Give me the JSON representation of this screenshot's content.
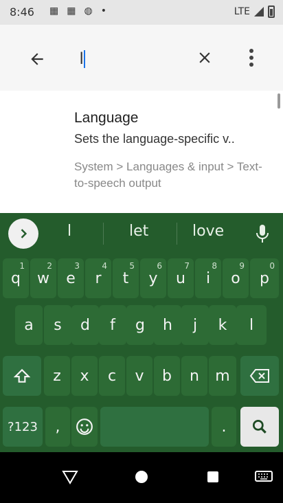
{
  "status_bar": {
    "time": "8:46",
    "network": "LTE",
    "icons": [
      "calendar-31-icon",
      "calendar-31-icon",
      "wifi-icon",
      "dot-icon"
    ]
  },
  "search_bar": {
    "query": "l",
    "back_icon": "arrow-left-icon",
    "clear_icon": "close-icon",
    "more_icon": "more-vertical-icon"
  },
  "result": {
    "title": "Language",
    "summary": "Sets the language-specific v..",
    "path": "System > Languages & input > Text-to-speech output"
  },
  "suggestions": [
    "l",
    "let",
    "love"
  ],
  "keyboard": {
    "row1": [
      {
        "label": "q",
        "hint": "1"
      },
      {
        "label": "w",
        "hint": "2"
      },
      {
        "label": "e",
        "hint": "3"
      },
      {
        "label": "r",
        "hint": "4"
      },
      {
        "label": "t",
        "hint": "5"
      },
      {
        "label": "y",
        "hint": "6"
      },
      {
        "label": "u",
        "hint": "7"
      },
      {
        "label": "i",
        "hint": "8"
      },
      {
        "label": "o",
        "hint": "9"
      },
      {
        "label": "p",
        "hint": "0"
      }
    ],
    "row2": [
      "a",
      "s",
      "d",
      "f",
      "g",
      "h",
      "j",
      "k",
      "l"
    ],
    "row3": [
      "z",
      "x",
      "c",
      "v",
      "b",
      "n",
      "m"
    ],
    "symbols_label": "?123",
    "comma": ",",
    "period": "."
  },
  "colors": {
    "keyboard_bg": "#245c2c",
    "key_bg": "#2d6b35",
    "accent": "#1a73e8"
  }
}
